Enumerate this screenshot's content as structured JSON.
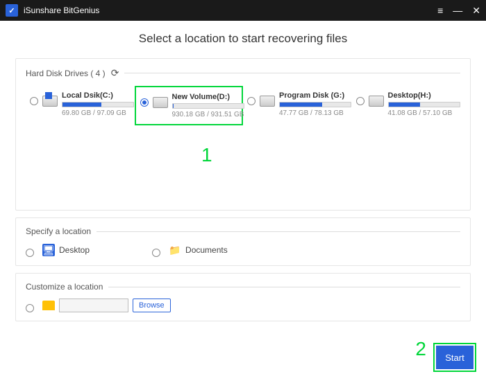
{
  "app": {
    "title": "iSunshare BitGenius"
  },
  "heading": "Select a location to start recovering files",
  "hdd": {
    "title": "Hard Disk Drives ( 4 )",
    "drives": [
      {
        "name": "Local Dsik(C:)",
        "size": "69.80 GB / 97.09 GB",
        "fill": 55,
        "win": true,
        "selected": false
      },
      {
        "name": "New Volume(D:)",
        "size": "930.18 GB / 931.51 GB",
        "fill": 1,
        "win": false,
        "selected": true
      },
      {
        "name": "Program Disk (G:)",
        "size": "47.77 GB / 78.13 GB",
        "fill": 60,
        "win": false,
        "selected": false
      },
      {
        "name": "Desktop(H:)",
        "size": "41.08 GB / 57.10 GB",
        "fill": 45,
        "win": false,
        "selected": false
      }
    ]
  },
  "specify": {
    "title": "Specify a location",
    "desktop": "Desktop",
    "documents": "Documents"
  },
  "customize": {
    "title": "Customize a location",
    "browse": "Browse",
    "path": ""
  },
  "start": "Start",
  "annotations": {
    "one": "1",
    "two": "2"
  }
}
